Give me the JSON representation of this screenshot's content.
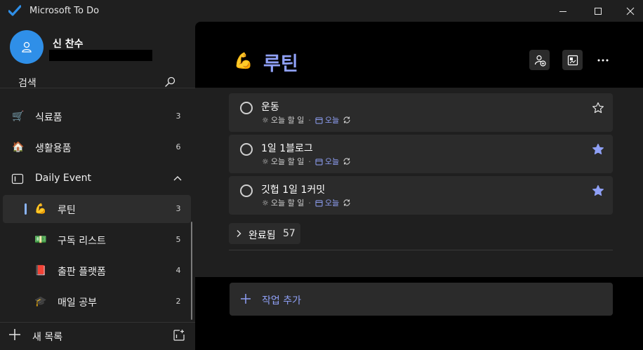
{
  "app": {
    "title": "Microsoft To Do",
    "accent": "#2f8fe8",
    "list_accent": "#8fa0f6"
  },
  "window_controls": [
    "minimize-icon",
    "maximize-icon",
    "close-icon"
  ],
  "user": {
    "name": "신 찬수",
    "avatar_icon": "person-icon"
  },
  "search": {
    "label": "검색",
    "icon": "search-icon"
  },
  "sidebar": {
    "lists": [
      {
        "icon": "🛒",
        "label": "식료품",
        "count": "3"
      },
      {
        "icon": "🏠",
        "label": "생활용품",
        "count": "6"
      }
    ],
    "group": {
      "icon": "group-icon",
      "label": "Daily Event",
      "expanded": true,
      "items": [
        {
          "icon": "💪",
          "label": "루틴",
          "count": "3",
          "active": true
        },
        {
          "icon": "💵",
          "label": "구독 리스트",
          "count": "5"
        },
        {
          "icon": "📕",
          "label": "출판 플랫폼",
          "count": "4"
        },
        {
          "icon": "🎓",
          "label": "매일 공부",
          "count": "2"
        }
      ]
    },
    "new_list": {
      "label": "새 목록"
    }
  },
  "main": {
    "list_icon": "💪",
    "title": "루틴",
    "header_buttons": [
      "share-list-icon",
      "change-theme-icon",
      "more-options-icon"
    ],
    "tasks": [
      {
        "title": "운동",
        "my_day": "오늘 할 일",
        "due": "오늘",
        "repeat": true,
        "important": false
      },
      {
        "title": "1일 1블로그",
        "my_day": "오늘 할 일",
        "due": "오늘",
        "repeat": true,
        "important": true
      },
      {
        "title": "깃헙 1일 1커밋",
        "my_day": "오늘 할 일",
        "due": "오늘",
        "repeat": true,
        "important": true
      }
    ],
    "completed": {
      "label": "완료됨",
      "count": "57"
    },
    "add_task": {
      "label": "작업 추가"
    }
  }
}
